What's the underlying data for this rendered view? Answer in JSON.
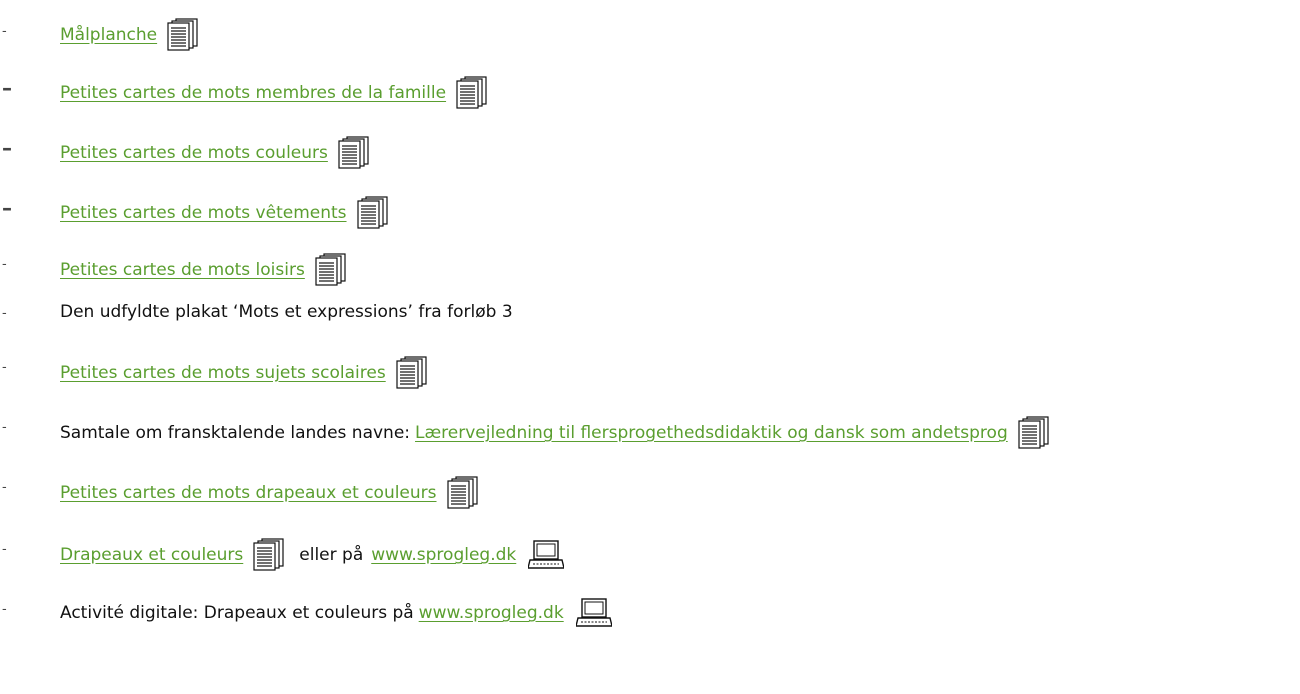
{
  "items": [
    {
      "dash": "-",
      "link": "Målplanche"
    },
    {
      "dash": "–",
      "link": "Petites cartes de mots membres de la famille"
    },
    {
      "dash": "–",
      "link": "Petites cartes de mots couleurs"
    },
    {
      "dash": "–",
      "link": "Petites cartes de mots vêtements"
    },
    {
      "dash": "-",
      "link": "Petites cartes de mots loisirs"
    },
    {
      "dash": "-",
      "text": "Den udfyldte plakat ‘Mots et expressions’ fra forløb 3"
    },
    {
      "dash": "-",
      "link": "Petites cartes de mots sujets scolaires"
    },
    {
      "dash": "-",
      "prefix": "Samtale om fransktalende landes navne: ",
      "link": "Lærervejledning til flersprogethedsdidaktik og dansk som andetsprog"
    },
    {
      "dash": "-",
      "link": "Petites cartes de mots drapeaux et couleurs"
    },
    {
      "dash": "-",
      "link": "Drapeaux et couleurs",
      "mid": "eller på",
      "link2": "www.sprogleg.dk"
    },
    {
      "dash": "-",
      "prefix": "Activité digitale: Drapeaux et couleurs på ",
      "link": "www.sprogleg.dk"
    }
  ],
  "icons": {
    "document": "document-icon",
    "computer": "computer-icon"
  },
  "colors": {
    "link": "#5a9e2f"
  }
}
